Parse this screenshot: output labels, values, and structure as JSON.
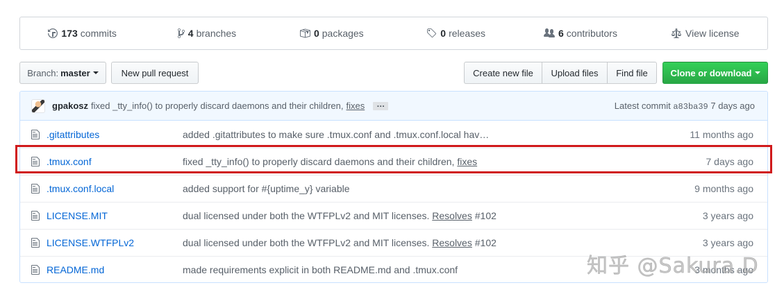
{
  "summary": [
    {
      "icon": "history-icon",
      "num": "173",
      "label": "commits"
    },
    {
      "icon": "branch-icon",
      "num": "4",
      "label": "branches"
    },
    {
      "icon": "package-icon",
      "num": "0",
      "label": "packages"
    },
    {
      "icon": "tag-icon",
      "num": "0",
      "label": "releases"
    },
    {
      "icon": "people-icon",
      "num": "6",
      "label": "contributors"
    },
    {
      "icon": "law-icon",
      "num": "",
      "label": "View license"
    }
  ],
  "toolbar": {
    "branch_label": "Branch:",
    "branch_value": "master",
    "new_pr": "New pull request",
    "create_file": "Create new file",
    "upload_files": "Upload files",
    "find_file": "Find file",
    "clone": "Clone or download"
  },
  "commit": {
    "author": "gpakosz",
    "message": "fixed _tty_info() to properly discard daemons and their children,",
    "link": "fixes",
    "ellipsis": "…",
    "latest_label": "Latest commit",
    "sha": "a83ba39",
    "age": "7 days ago"
  },
  "files": [
    {
      "name": ".gitattributes",
      "msg": "added .gitattributes to make sure .tmux.conf and .tmux.conf.local hav…",
      "link": "",
      "issue": "",
      "age": "11 months ago"
    },
    {
      "name": ".tmux.conf",
      "msg": "fixed _tty_info() to properly discard daemons and their children,",
      "link": "fixes",
      "issue": "",
      "age": "7 days ago"
    },
    {
      "name": ".tmux.conf.local",
      "msg": "added support for #{uptime_y} variable",
      "link": "",
      "issue": "",
      "age": "9 months ago"
    },
    {
      "name": "LICENSE.MIT",
      "msg": "dual licensed under both the WTFPLv2 and MIT licenses.",
      "link": "Resolves",
      "issue": "#102",
      "age": "3 years ago"
    },
    {
      "name": "LICENSE.WTFPLv2",
      "msg": "dual licensed under both the WTFPLv2 and MIT licenses.",
      "link": "Resolves",
      "issue": "#102",
      "age": "3 years ago"
    },
    {
      "name": "README.md",
      "msg": "made requirements explicit in both README.md and .tmux.conf",
      "link": "",
      "issue": "",
      "age": "3 months ago"
    }
  ],
  "watermark": "知乎 @Sakura.D",
  "colors": {
    "accent": "#0366d6",
    "clone_green": "#28a745",
    "highlight": "#d0191b"
  }
}
